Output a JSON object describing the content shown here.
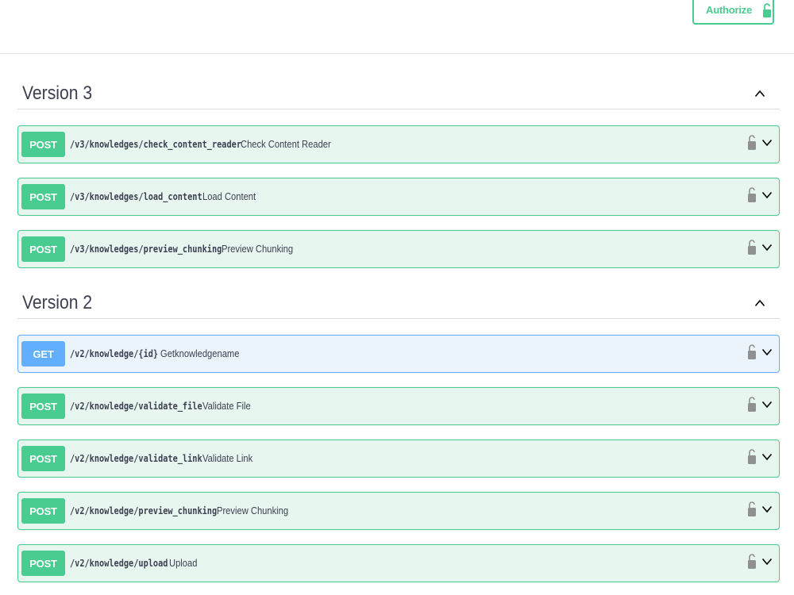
{
  "header": {
    "authorize_label": "Authorize",
    "authorize_icon": "lock-open-icon",
    "accent_color": "#49cc90"
  },
  "sections": [
    {
      "title": "Version 3",
      "toggle_icon": "chevron-up-icon",
      "operations": [
        {
          "method": "POST",
          "path": "/v3/knowledges/check_content_reader",
          "summary": "Check Content Reader"
        },
        {
          "method": "POST",
          "path": "/v3/knowledges/load_content",
          "summary": "Load Content"
        },
        {
          "method": "POST",
          "path": "/v3/knowledges/preview_chunking",
          "summary": "Preview Chunking"
        }
      ]
    },
    {
      "title": "Version 2",
      "toggle_icon": "chevron-up-icon",
      "operations": [
        {
          "method": "GET",
          "path": "/v2/knowledge/{id}",
          "summary": "Getknowledgename"
        },
        {
          "method": "POST",
          "path": "/v2/knowledge/validate_file",
          "summary": "Validate File"
        },
        {
          "method": "POST",
          "path": "/v2/knowledge/validate_link",
          "summary": "Validate Link"
        },
        {
          "method": "POST",
          "path": "/v2/knowledge/preview_chunking",
          "summary": "Preview Chunking"
        },
        {
          "method": "POST",
          "path": "/v2/knowledge/upload",
          "summary": "Upload"
        }
      ]
    }
  ],
  "colors": {
    "post": "#49cc90",
    "post_bg": "#e8f6f0",
    "get": "#61affe",
    "get_bg": "#ebf3fb"
  }
}
